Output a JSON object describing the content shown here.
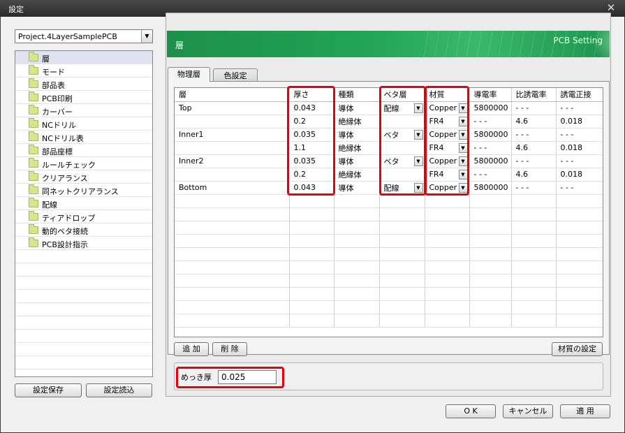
{
  "window": {
    "title": "設定",
    "close_glyph": "✕"
  },
  "project": {
    "selected": "Project.4LayerSamplePCB",
    "dropdown_glyph": "▼"
  },
  "tree": {
    "items": [
      "層",
      "モード",
      "部品表",
      "PCB印刷",
      "カーバー",
      "NCドリル",
      "NCドリル表",
      "部品座標",
      "ルールチェック",
      "クリアランス",
      "同ネットクリアランス",
      "配線",
      "ティアドロップ",
      "動的ベタ接続",
      "PCB設計指示"
    ],
    "selected_index": 0
  },
  "left_buttons": {
    "save": "設定保存",
    "load": "設定読込"
  },
  "banner": {
    "title": "層",
    "subtitle": "PCB Setting",
    "color": "#22a455"
  },
  "tabs": [
    {
      "label": "物理層",
      "active": true
    },
    {
      "label": "色設定",
      "active": false
    }
  ],
  "table": {
    "columns": [
      "層",
      "厚さ",
      "種類",
      "ベタ層",
      "材質",
      "導電率",
      "比誘電率",
      "誘電正接"
    ],
    "rows": [
      [
        "Top",
        "0.043",
        "導体",
        "配線",
        "Copper",
        "5800000",
        "- - -",
        "- - -"
      ],
      [
        "",
        "0.2",
        "絶縁体",
        "",
        "FR4",
        "- - -",
        "4.6",
        "0.018"
      ],
      [
        "Inner1",
        "0.035",
        "導体",
        "ベタ",
        "Copper",
        "5800000",
        "- - -",
        "- - -"
      ],
      [
        "",
        "1.1",
        "絶縁体",
        "",
        "FR4",
        "- - -",
        "4.6",
        "0.018"
      ],
      [
        "Inner2",
        "0.035",
        "導体",
        "ベタ",
        "Copper",
        "5800000",
        "- - -",
        "- - -"
      ],
      [
        "",
        "0.2",
        "絶縁体",
        "",
        "FR4",
        "- - -",
        "4.6",
        "0.018"
      ],
      [
        "Bottom",
        "0.043",
        "導体",
        "配線",
        "Copper",
        "5800000",
        "- - -",
        "- - -"
      ]
    ],
    "dropdown_columns": [
      3,
      4
    ],
    "dropdown_glyph": "▼"
  },
  "grid_buttons": {
    "add": "追 加",
    "delete": "削 除",
    "material": "材質の設定"
  },
  "plating": {
    "label": "めっき厚",
    "value": "0.025"
  },
  "footer_buttons": {
    "ok": "O K",
    "cancel": "キャンセル",
    "apply": "適 用"
  },
  "highlight_color": "#e8000c"
}
